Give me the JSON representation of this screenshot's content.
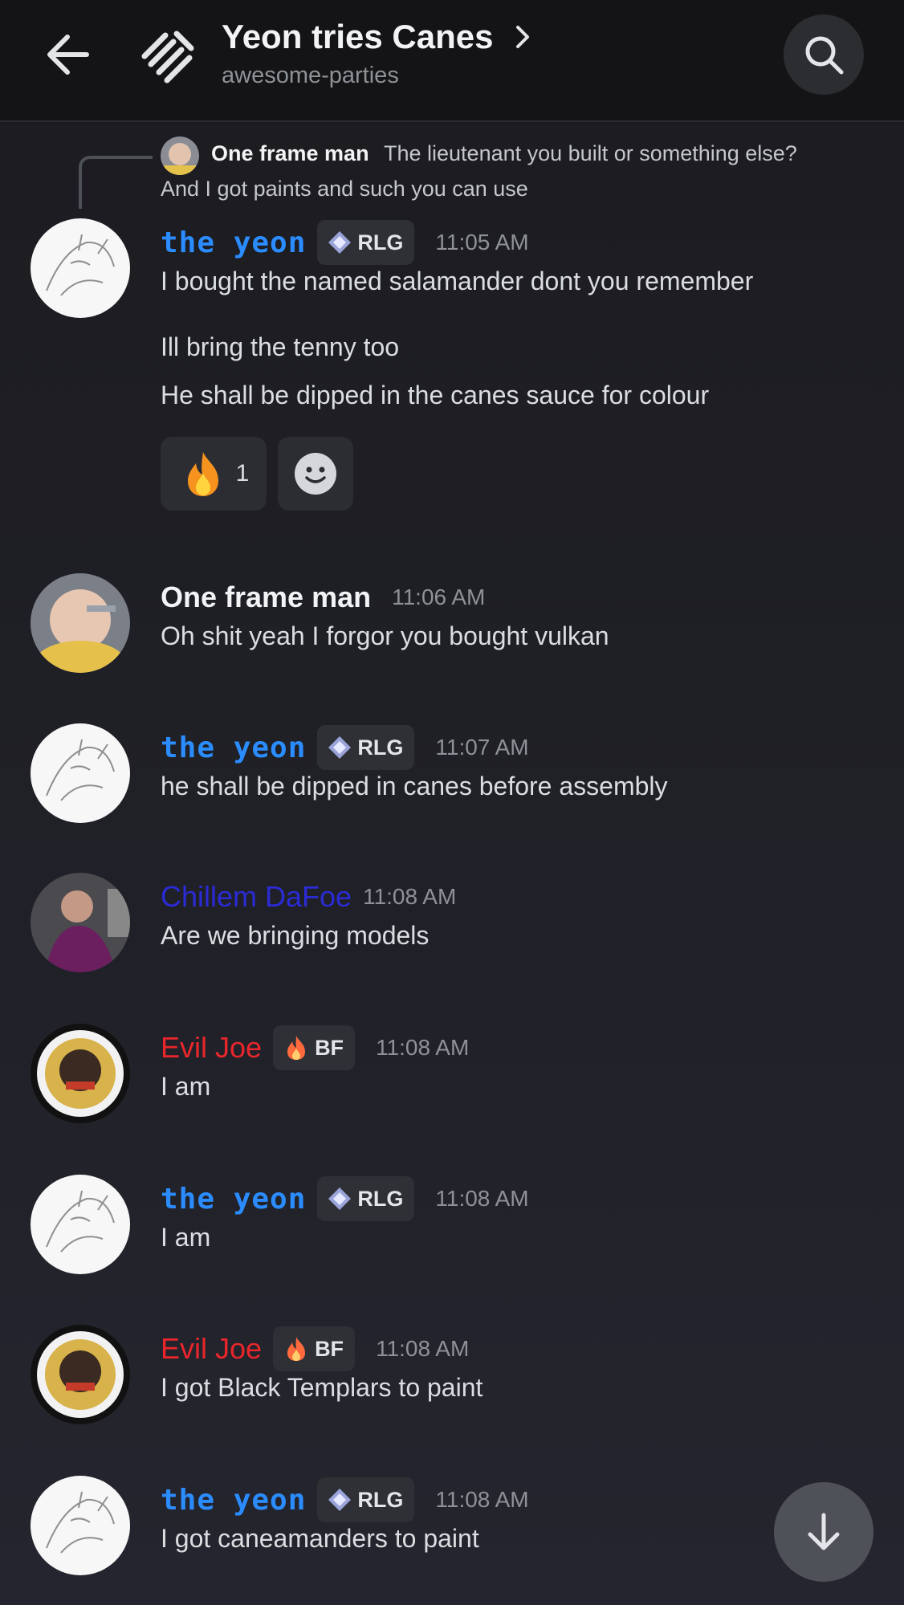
{
  "header": {
    "title": "Yeon tries Canes",
    "subtitle": "awesome-parties"
  },
  "reply": {
    "author": "One frame man",
    "text_line1": "The lieutenant you built or something else?",
    "text_line2": "And I got paints and such you can use"
  },
  "messages": [
    {
      "author": "the yeon",
      "tag": "RLG",
      "time": "11:05 AM",
      "lines": [
        "I bought the named salamander dont you remember",
        "Ill bring the tenny too",
        "He shall be dipped in the canes sauce for colour"
      ],
      "reactions": [
        {
          "emoji": "fire",
          "count": "1"
        }
      ]
    },
    {
      "author": "One frame man",
      "time": "11:06 AM",
      "lines": [
        "Oh shit yeah I forgor you bought vulkan"
      ]
    },
    {
      "author": "the yeon",
      "tag": "RLG",
      "time": "11:07 AM",
      "lines": [
        "he shall be dipped in canes before assembly"
      ]
    },
    {
      "author": "Chillem DaFoe",
      "time": "11:08 AM",
      "lines": [
        "Are we bringing models"
      ]
    },
    {
      "author": "Evil Joe",
      "tag": "BF",
      "time": "11:08 AM",
      "lines": [
        "I am"
      ]
    },
    {
      "author": "the yeon",
      "tag": "RLG",
      "time": "11:08 AM",
      "lines": [
        "I am"
      ]
    },
    {
      "author": "Evil Joe",
      "tag": "BF",
      "time": "11:08 AM",
      "lines": [
        "I got Black Templars to paint"
      ]
    },
    {
      "author": "the yeon",
      "tag": "RLG",
      "time": "11:08 AM",
      "lines": [
        "I got caneamanders to paint"
      ]
    }
  ],
  "colors": {
    "background": "#1a1a1e",
    "yeon_name": "#2a8cff",
    "chillem_name": "#2b2bd6",
    "evil_joe_name": "#e8262b"
  },
  "icons": [
    "back-arrow-icon",
    "channel-thread-icon",
    "chevron-right-icon",
    "search-icon",
    "diamond-icon",
    "flame-icon",
    "fire-emoji-icon",
    "add-reaction-icon",
    "arrow-down-icon"
  ]
}
